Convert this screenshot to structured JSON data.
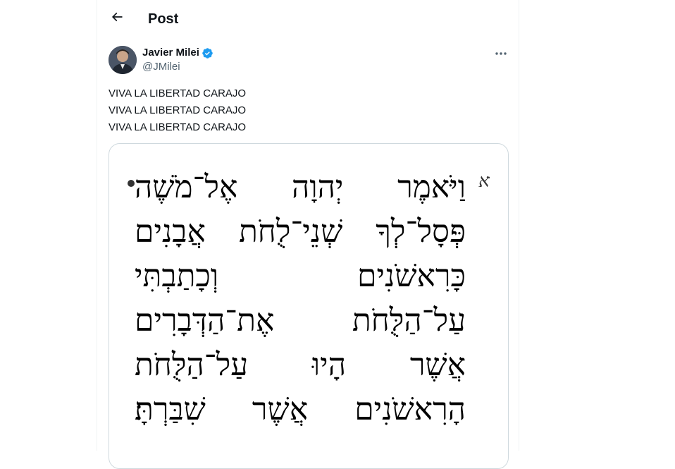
{
  "header": {
    "back_icon": "arrow-left-icon",
    "title": "Post"
  },
  "author": {
    "name": "Javier Milei",
    "handle": "@JMilei",
    "verified_icon": "verified-badge-icon",
    "verified_color": "#1d9bf0"
  },
  "post": {
    "lines": [
      "VIVA LA LIBERTAD CARAJO",
      "VIVA LA LIBERTAD CARAJO",
      "VIVA LA LIBERTAD CARAJO"
    ],
    "more_icon": "more-horizontal-icon"
  },
  "media": {
    "verse_number": "א",
    "hebrew_lines": [
      "וַיֹּאמֶר יְהוָה אֶל־מֹשֶׁה",
      "פְּסָל־לְךָ שְׁנֵי־לֻחֹת אֲבָנִים",
      "כָּרִאשֹׁנִים וְכָתַבְתִּי",
      "עַל־הַלֻּחֹת אֶת־הַדְּבָרִים",
      "אֲשֶׁר הָיוּ עַל־הַלֻּחֹת",
      "הָרִאשֹׁנִים אֲשֶׁר שִׁבַּרְתָּ׃"
    ]
  }
}
